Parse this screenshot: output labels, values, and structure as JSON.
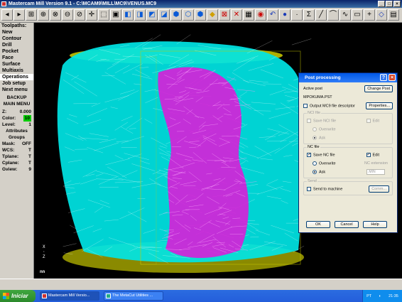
{
  "window": {
    "title": "Mastercam Mill Version 9.1 - C:\\MCAM9\\MILL\\MC9\\VENUS.MC9",
    "controls": [
      "_",
      "□",
      "×"
    ]
  },
  "toolbar": {
    "icons": [
      "arrow-left-icon",
      "arrow-right-icon",
      "select-icon",
      "zoom-icon",
      "zoom-window-icon",
      "zoom-out-icon",
      "unzoom-icon",
      "fit-icon",
      "pan-icon",
      "screen-icon",
      "view-top-icon",
      "view-front-icon",
      "view-side-icon",
      "view-iso-icon",
      "cube-icon",
      "cube-icon",
      "cube-icon",
      "shade-icon",
      "verify-icon",
      "delete-icon",
      "hide-icon",
      "colors-icon",
      "undo-icon",
      "sphere-icon",
      "point-icon",
      "sum-icon",
      "line-icon",
      "arc-icon",
      "curve-icon",
      "rect-icon",
      "plus-icon",
      "diamond-icon",
      "exit-icon"
    ]
  },
  "sidebar": {
    "title": "Toolpaths:",
    "items": [
      {
        "label": "New",
        "selected": false
      },
      {
        "label": "Contour",
        "selected": false
      },
      {
        "label": "Drill",
        "selected": false
      },
      {
        "label": "Pocket",
        "selected": false
      },
      {
        "label": "Face",
        "selected": false
      },
      {
        "label": "Surface",
        "selected": false
      },
      {
        "label": "Multiaxis",
        "selected": false
      },
      {
        "label": "Operations",
        "selected": true
      },
      {
        "label": "Job setup",
        "selected": false
      },
      {
        "label": "Next menu",
        "selected": false
      }
    ],
    "backup_label": "BACKUP",
    "main_menu_label": "MAIN MENU",
    "status": {
      "z_label": "Z:",
      "z_value": "0.000",
      "color_label": "Color:",
      "color_value": "10",
      "level_label": "Level:",
      "level_value": "1",
      "attributes_label": "Attributes",
      "groups_label": "Groups",
      "mask_label": "Mask:",
      "mask_value": "OFF",
      "wcs_label": "WCS:",
      "wcs_value": "T",
      "tplane_label": "Tplane:",
      "tplane_value": "T",
      "cplane_label": "Cplane:",
      "cplane_value": "T",
      "gview_label": "Gview:",
      "gview_value": "9"
    }
  },
  "viewport": {
    "axes_label": "X\n\nZ",
    "corner_label": "nn"
  },
  "dialog": {
    "title": "Post processing",
    "active_post_label": "Active post",
    "change_post_label": "Change Post",
    "active_post_value": "MPOKUMA.PST",
    "output_mc9_label": "Output MC9 file descriptor",
    "properties_label": "Properties...",
    "nci_group_label": "NCI file",
    "save_nci_label": "Save NCI file",
    "nci_edit_label": "Edit",
    "nci_overwrite_label": "Overwrite",
    "nci_ask_label": "Ask",
    "nc_group_label": "NC file",
    "save_nc_label": "Save NC file",
    "nc_edit_label": "Edit",
    "nc_overwrite_label": "Overwrite",
    "nc_extension_label": "NC extension",
    "nc_ask_label": "Ask",
    "nc_extension_value": ".MIN",
    "send_group_label": "Send",
    "send_label": "Send to machine",
    "comm_label": "Comm...",
    "ok_label": "OK",
    "cancel_label": "Cancel",
    "help_label": "Help",
    "save_nci_checked": false,
    "save_nc_checked": true,
    "nc_edit_checked": true
  },
  "taskbar": {
    "start_label": "Iniciar",
    "tasks": [
      {
        "label": "Mastercam Mill Versio..."
      },
      {
        "label": "The MetaCut Utilities ..."
      }
    ],
    "lang": "PT",
    "time": "21:35"
  },
  "colors": {
    "cyan_toolpath": "#00e5e5",
    "magenta_toolpath": "#d81ed8",
    "yellow_stock": "#c8c800",
    "accent_blue": "#0058e6"
  }
}
